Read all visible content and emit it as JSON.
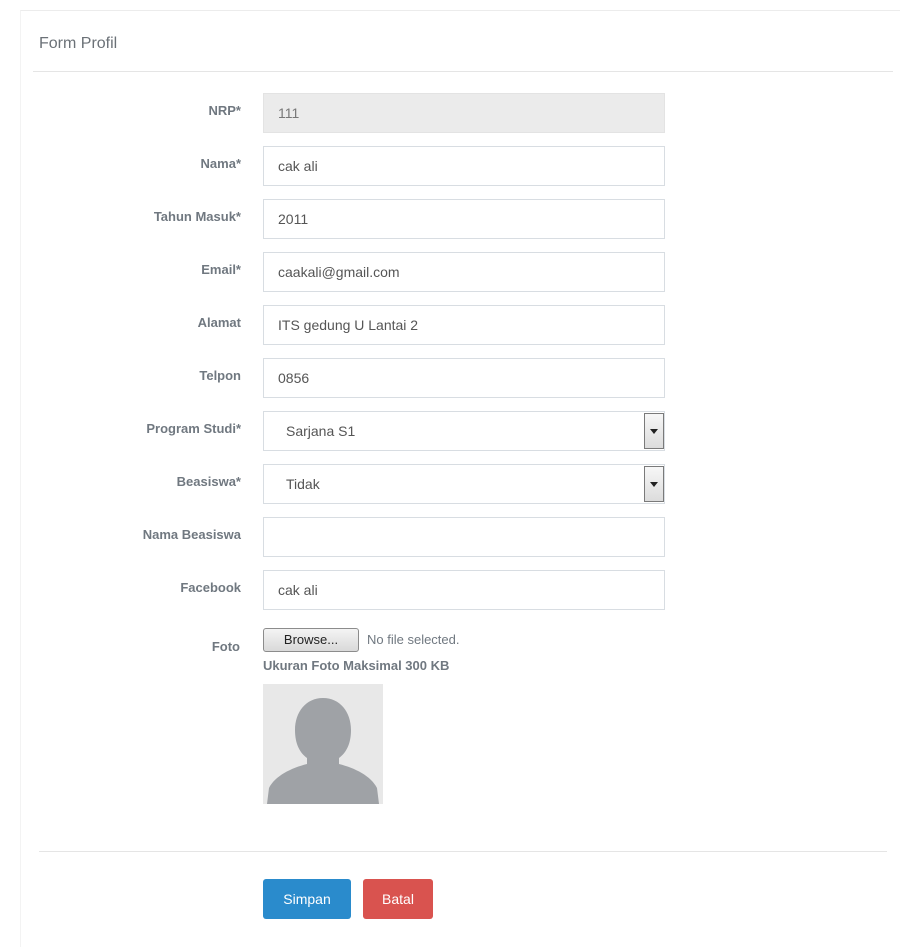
{
  "panel": {
    "title": "Form Profil"
  },
  "form": {
    "fields": [
      {
        "label": "NRP*",
        "value": "111",
        "readonly": true,
        "type": "text"
      },
      {
        "label": "Nama*",
        "value": "cak ali",
        "type": "text"
      },
      {
        "label": "Tahun Masuk*",
        "value": "2011",
        "type": "text"
      },
      {
        "label": "Email*",
        "value": "caakali@gmail.com",
        "type": "text"
      },
      {
        "label": "Alamat",
        "value": "ITS gedung U Lantai 2",
        "type": "text"
      },
      {
        "label": "Telpon",
        "value": "0856",
        "type": "text"
      },
      {
        "label": "Program Studi*",
        "value": "Sarjana S1",
        "type": "select"
      },
      {
        "label": "Beasiswa*",
        "value": "Tidak",
        "type": "select"
      },
      {
        "label": "Nama Beasiswa",
        "value": "",
        "type": "text"
      },
      {
        "label": "Facebook",
        "value": "cak ali",
        "type": "text"
      }
    ],
    "foto": {
      "label": "Foto",
      "browse_label": "Browse...",
      "no_file_text": "No file selected.",
      "hint": "Ukuran Foto Maksimal 300 KB",
      "avatar_icon": "person-silhouette-icon"
    }
  },
  "actions": {
    "save_label": "Simpan",
    "cancel_label": "Batal",
    "save_color": "#2a8bcc",
    "cancel_color": "#d9534f"
  }
}
